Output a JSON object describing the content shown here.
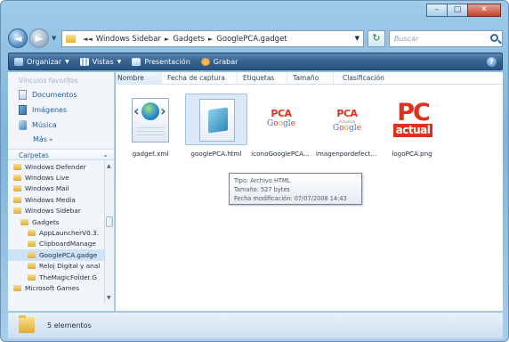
{
  "window": {
    "buttons": {
      "minimize": "–",
      "maximize": "□",
      "close": "✕"
    }
  },
  "navigation": {
    "back": "◄",
    "forward": "►",
    "refresh": "↻",
    "breadcrumb": [
      "Windows Sidebar",
      "Gadgets",
      "GooglePCA.gadget"
    ],
    "search_placeholder": "Buscar"
  },
  "toolbar": {
    "items": [
      {
        "label": "Organizar",
        "icon": "organize-icon",
        "dropdown": true
      },
      {
        "label": "Vistas",
        "icon": "views-icon",
        "dropdown": true
      },
      {
        "label": "Presentación",
        "icon": "slideshow-icon",
        "dropdown": false
      },
      {
        "label": "Grabar",
        "icon": "burn-icon",
        "dropdown": false
      }
    ],
    "help": "?"
  },
  "sidebar": {
    "favorites_title": "Vínculos favoritos",
    "favorites": [
      {
        "label": "Documentos",
        "icon": "documents-icon"
      },
      {
        "label": "Imágenes",
        "icon": "pictures-icon"
      },
      {
        "label": "Música",
        "icon": "music-icon"
      }
    ],
    "more": "Más",
    "folders_title": "Carpetas",
    "tree": [
      {
        "label": "Windows Defender",
        "indent": 0
      },
      {
        "label": "Windows Live",
        "indent": 0
      },
      {
        "label": "Windows Mail",
        "indent": 0
      },
      {
        "label": "Windows Media",
        "indent": 0
      },
      {
        "label": "Windows Sidebar",
        "indent": 0
      },
      {
        "label": "Gadgets",
        "indent": 1
      },
      {
        "label": "AppLauncherV0.3.",
        "indent": 2
      },
      {
        "label": "ClipboardManage",
        "indent": 2
      },
      {
        "label": "GooglePCA.gadge",
        "indent": 2
      },
      {
        "label": "Reloj Digital y anal",
        "indent": 2
      },
      {
        "label": "TheMagicFolder.G",
        "indent": 2
      },
      {
        "label": "Microsoft Games",
        "indent": 0
      }
    ]
  },
  "columns": [
    "Nombre",
    "Fecha de captura",
    "Etiquetas",
    "Tamaño",
    "Clasificación"
  ],
  "files": [
    {
      "name": "gadget.xml",
      "icon": "xml-file-icon"
    },
    {
      "name": "googlePCA.html",
      "icon": "html-file-icon"
    },
    {
      "name": "iconoGooglePCA...",
      "icon": "pca-google-icon"
    },
    {
      "name": "imagenpordefect...",
      "icon": "pca-google-default-icon"
    },
    {
      "name": "logoPCA.png",
      "icon": "pc-actual-logo-icon"
    }
  ],
  "thumbs": {
    "pca": "PCA",
    "google": [
      "G",
      "o",
      "o",
      "g",
      "l",
      "e"
    ],
    "tag": "Actualiza",
    "pc": "PC",
    "actual": "actual"
  },
  "tooltip": {
    "type": "Tipo: Archivo HTML",
    "size": "Tamaño: 527 bytes",
    "modified": "Fecha modificación: 07/07/2008 14:43"
  },
  "status": {
    "count": "5 elementos"
  },
  "colors": {
    "accent": "#35628f",
    "link": "#1d5fa3",
    "brand_red": "#e0301e"
  }
}
